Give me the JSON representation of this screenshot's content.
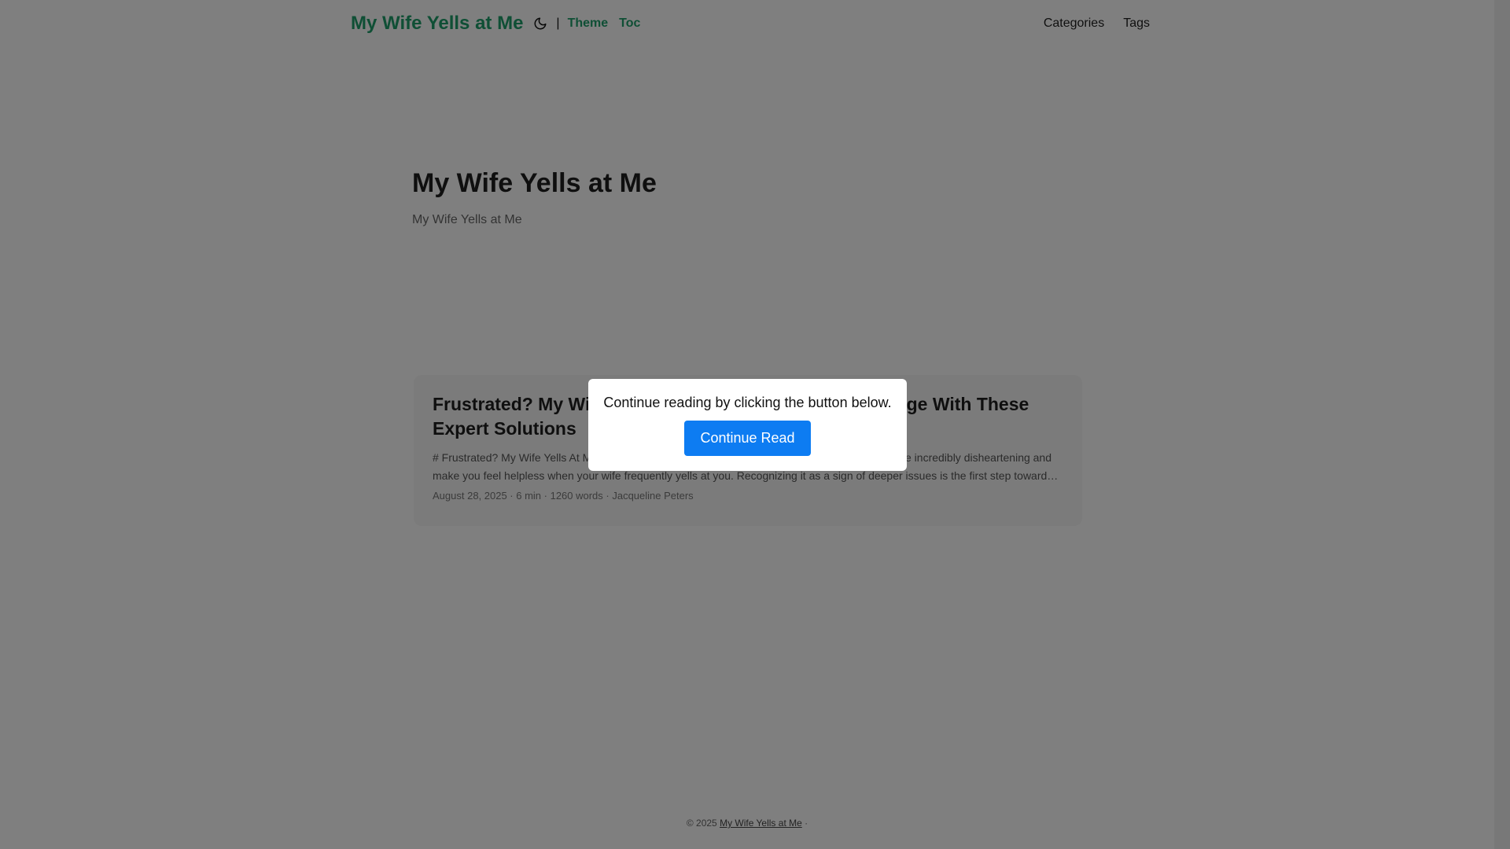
{
  "header": {
    "logo": "My Wife Yells at Me",
    "separator": "|",
    "links": [
      "Theme",
      "Toc"
    ],
    "nav": [
      "Categories",
      "Tags"
    ],
    "icons": {
      "theme_toggle": "moon-icon"
    }
  },
  "hero": {
    "title": "My Wife Yells at Me",
    "description": "My Wife Yells at Me"
  },
  "post": {
    "title": "Frustrated? My Wife Yells At Me Constantly? Take Charge With These Expert Solutions",
    "excerpt": "# Frustrated? My Wife Yells At Me Constantly? Take Charge With These Expert Solutions It can be incredibly disheartening and make you feel helpless when your wife frequently yells at you. Recognizing it as a sign of deeper issues is the first step toward…",
    "meta": "August 28, 2025 · 6 min · 1260 words · Jacqueline Peters"
  },
  "footer": {
    "copyright": "© 2025",
    "site_link": "My Wife Yells at Me",
    "trail": "·"
  },
  "modal": {
    "text": "Continue reading by clicking the button below.",
    "button": "Continue Read"
  },
  "colors": {
    "accent": "#1f9e6a",
    "button": "#0d7cf2",
    "overlay": "rgba(0,0,0,0.5)"
  }
}
